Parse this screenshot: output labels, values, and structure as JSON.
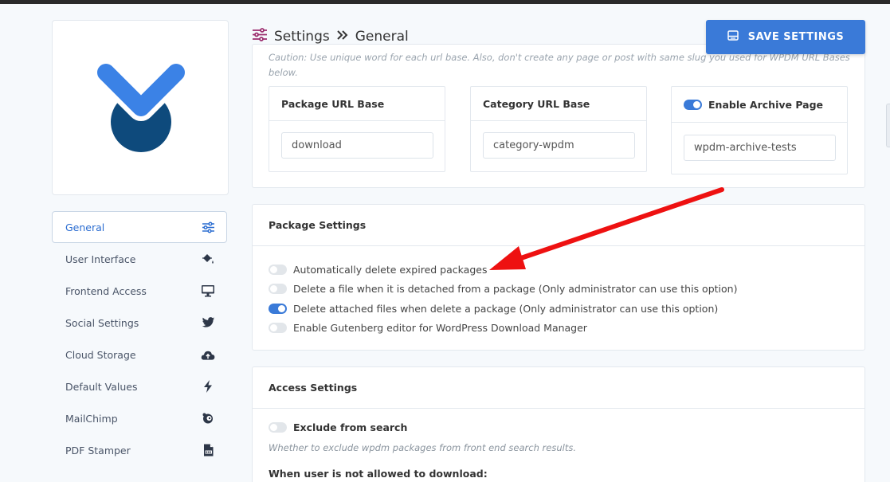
{
  "header": {
    "title": "Settings",
    "subtitle": "General",
    "save_label": "SAVE SETTINGS"
  },
  "sidebar": {
    "items": [
      {
        "label": "General",
        "icon": "sliders-icon",
        "active": true
      },
      {
        "label": "User Interface",
        "icon": "paint-bucket-icon"
      },
      {
        "label": "Frontend Access",
        "icon": "monitor-icon"
      },
      {
        "label": "Social Settings",
        "icon": "twitter-icon"
      },
      {
        "label": "Cloud Storage",
        "icon": "cloud-upload-icon"
      },
      {
        "label": "Default Values",
        "icon": "bolt-icon"
      },
      {
        "label": "MailChimp",
        "icon": "mailchimp-icon"
      },
      {
        "label": "PDF Stamper",
        "icon": "pdf-file-icon"
      }
    ]
  },
  "url_bases": {
    "caution": "Caution: Use unique word for each url base. Also, don't create any page or post with same slug you used for WPDM URL Bases below.",
    "package": {
      "title": "Package URL Base",
      "value": "download"
    },
    "category": {
      "title": "Category URL Base",
      "value": "category-wpdm"
    },
    "archive": {
      "title": "Enable Archive Page",
      "value": "wpdm-archive-tests",
      "enabled": true
    }
  },
  "package_settings": {
    "title": "Package Settings",
    "options": [
      {
        "label": "Automatically delete expired packages",
        "enabled": false
      },
      {
        "label": "Delete a file when it is detached from a package (Only administrator can use this option)",
        "enabled": false
      },
      {
        "label": "Delete attached files when delete a package (Only administrator can use this option)",
        "enabled": true
      },
      {
        "label": "Enable Gutenberg editor for WordPress Download Manager",
        "enabled": false
      }
    ]
  },
  "access_settings": {
    "title": "Access Settings",
    "exclude_label": "Exclude from search",
    "exclude_enabled": false,
    "exclude_desc": "Whether to exclude wpdm packages from front end search results.",
    "when_label": "When user is not allowed to download:"
  },
  "colors": {
    "accent": "#3a7ad8",
    "logo_light": "#3b82e6",
    "logo_dark": "#0e4a7c",
    "title_icon": "#9b2d6e",
    "annotation_arrow": "#ee1111"
  }
}
